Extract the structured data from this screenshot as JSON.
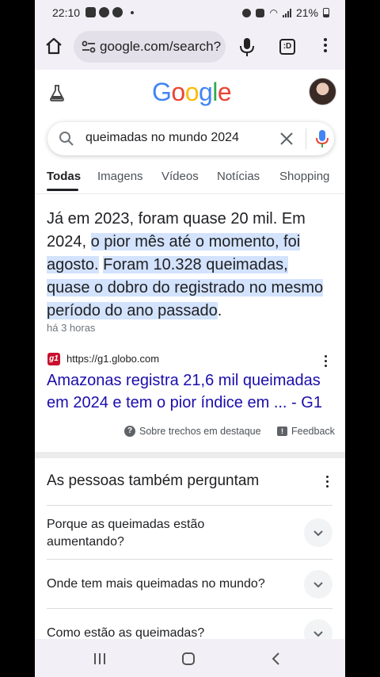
{
  "status_bar": {
    "time": "22:10",
    "battery": "21%"
  },
  "browser": {
    "url": "google.com/search?",
    "tabs_label": ":D"
  },
  "google": {
    "logo": [
      "G",
      "o",
      "o",
      "g",
      "l",
      "e"
    ],
    "logo_colors": [
      "#4285F4",
      "#EA4335",
      "#FBBC05",
      "#4285F4",
      "#34A853",
      "#EA4335"
    ],
    "query": "queimadas no mundo 2024",
    "filters": [
      "Todas",
      "Imagens",
      "Vídeos",
      "Notícias",
      "Shopping"
    ],
    "active_filter": "Todas"
  },
  "featured_snippet": {
    "text_plain": "Já em 2023, foram quase 20 mil. Em 2024, ",
    "text_highlight_1": "o pior mês até o momento, foi agosto.",
    "text_gap": " ",
    "text_highlight_2": "Foram 10.328 queimadas, quase o dobro do registrado no mesmo período do ano passado",
    "text_end": ".",
    "age": "há 3 horas",
    "source_favicon": "g1",
    "source_url": "https://g1.globo.com",
    "result_title": "Amazonas registra 21,6 mil queimadas em 2024 e tem o pior índice em ... - G1",
    "about_label": "Sobre trechos em destaque",
    "feedback_label": "Feedback"
  },
  "people_also_ask": {
    "title": "As pessoas também perguntam",
    "questions": [
      "Porque as queimadas estão aumentando?",
      "Onde tem mais queimadas no mundo?",
      "Como estão as queimadas?"
    ]
  }
}
